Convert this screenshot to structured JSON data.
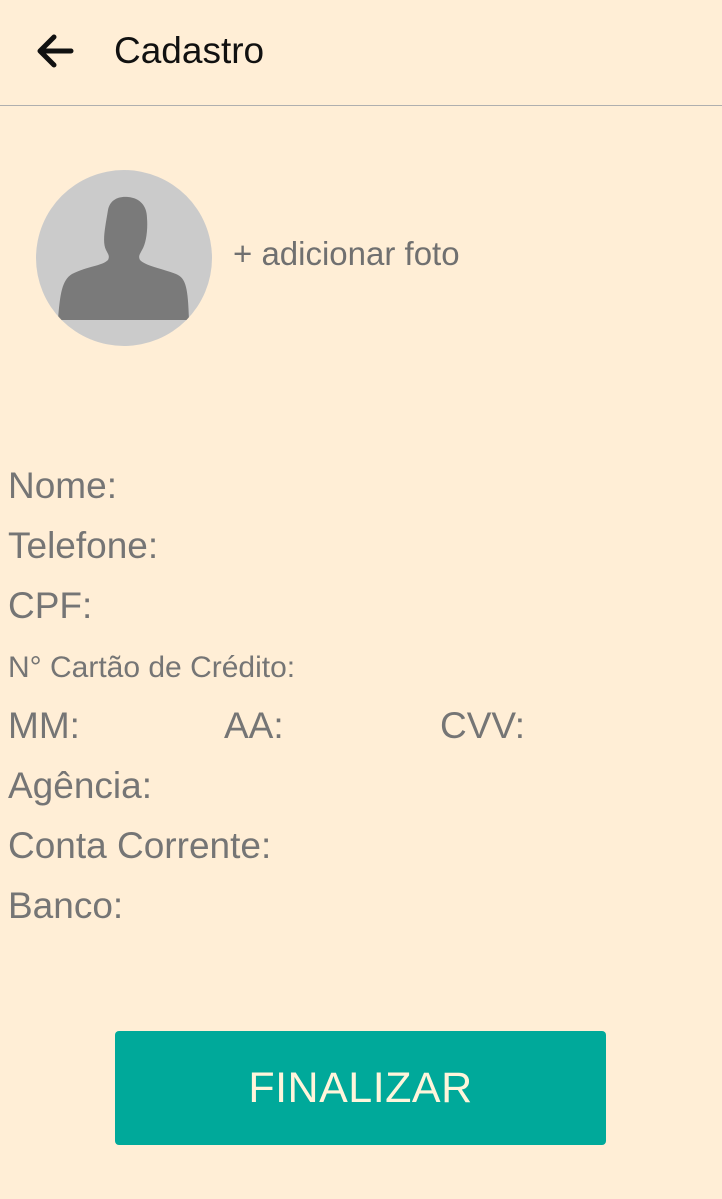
{
  "header": {
    "title": "Cadastro",
    "back_icon": "arrow-left-icon"
  },
  "photo": {
    "avatar_icon": "person-silhouette-icon",
    "add_label": "+ adicionar foto"
  },
  "form": {
    "nome": "Nome:",
    "telefone": "Telefone:",
    "cpf": "CPF:",
    "cartao": "N° Cartão de Crédito:",
    "mm": "MM:",
    "aa": "AA:",
    "cvv": "CVV:",
    "agencia": "Agência:",
    "conta": "Conta Corrente:",
    "banco": "Banco:"
  },
  "actions": {
    "finalize_label": "FINALIZAR"
  },
  "colors": {
    "background": "#FFEED6",
    "accent": "#00A99A",
    "label_text": "#757575",
    "avatar_bg": "#CBCBCB",
    "avatar_fg": "#7A7A7A"
  }
}
